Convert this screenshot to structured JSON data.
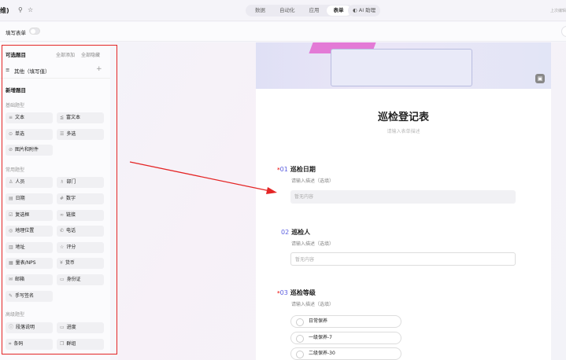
{
  "header": {
    "title": "维)",
    "tabs": [
      "数据",
      "自动化",
      "应用",
      "表单"
    ],
    "active_tab": "表单",
    "ai": "AI 助理",
    "last_edit": "上次编辑"
  },
  "subbar": {
    "label": "填写表单"
  },
  "panel": {
    "optional_title": "可选题目",
    "add_all": "全部添加",
    "hide_all": "全部隐藏",
    "other_item": "其他（填写值）",
    "new_title": "新增题目",
    "groups": [
      {
        "name": "基础题型",
        "items": [
          {
            "label": "文本",
            "icon": "≡"
          },
          {
            "label": "富文本",
            "icon": "≦"
          },
          {
            "label": "单选",
            "icon": "⊙"
          },
          {
            "label": "多选",
            "icon": "☰"
          },
          {
            "label": "图片和附件",
            "icon": "⊘"
          }
        ]
      },
      {
        "name": "常用题型",
        "items": [
          {
            "label": "人员",
            "icon": "♙"
          },
          {
            "label": "部门",
            "icon": "♗"
          },
          {
            "label": "日期",
            "icon": "▤"
          },
          {
            "label": "数字",
            "icon": "#"
          },
          {
            "label": "复选框",
            "icon": "☑"
          },
          {
            "label": "链接",
            "icon": "∞"
          },
          {
            "label": "地理位置",
            "icon": "◎"
          },
          {
            "label": "电话",
            "icon": "✆"
          },
          {
            "label": "地址",
            "icon": "▥"
          },
          {
            "label": "评分",
            "icon": "☆"
          },
          {
            "label": "量表/NPS",
            "icon": "▦"
          },
          {
            "label": "货币",
            "icon": "¥"
          },
          {
            "label": "邮箱",
            "icon": "✉"
          },
          {
            "label": "身份证",
            "icon": "▭"
          },
          {
            "label": "手写签名",
            "icon": "✎"
          }
        ]
      },
      {
        "name": "高级题型",
        "items": [
          {
            "label": "段落说明",
            "icon": "ⓘ"
          },
          {
            "label": "进度",
            "icon": "▭"
          },
          {
            "label": "条码",
            "icon": "⌗"
          },
          {
            "label": "群组",
            "icon": "❐"
          }
        ]
      }
    ]
  },
  "form": {
    "title": "巡检登记表",
    "description": "请输入表单描述",
    "questions": [
      {
        "num": "01",
        "title": "巡检日期",
        "required": "*",
        "desc": "请输入描述（选填）",
        "placeholder": "暂无内容"
      },
      {
        "num": "02",
        "title": "巡检人",
        "desc": "请输入描述（选填）",
        "placeholder": "暂无内容"
      },
      {
        "num": "03",
        "title": "巡检等级",
        "required": "*",
        "desc": "请输入描述（选填）",
        "options": [
          "日常保养",
          "一级保养-7",
          "二级保养-30"
        ]
      }
    ]
  },
  "colors": {
    "accent": "#5b5fe0",
    "annotation": "#e42525"
  }
}
